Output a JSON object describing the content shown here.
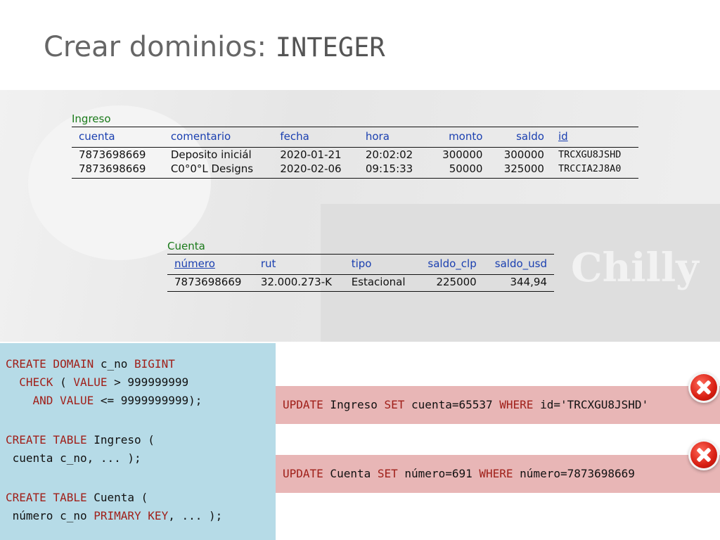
{
  "slide": {
    "title_text": "Crear dominios: ",
    "title_code": "INTEGER",
    "background_watermark": "Chilly"
  },
  "ingreso": {
    "caption": "Ingreso",
    "columns": [
      "cuenta",
      "comentario",
      "fecha",
      "hora",
      "monto",
      "saldo",
      "id"
    ],
    "rows": [
      [
        "7873698669",
        "Deposito iniciál",
        "2020-01-21",
        "20:02:02",
        "300000",
        "300000",
        "TRCXGU8JSHD"
      ],
      [
        "7873698669",
        "C0°0°L Designs",
        "2020-02-06",
        "09:15:33",
        "50000",
        "325000",
        "TRCCIA2J8A0"
      ]
    ]
  },
  "cuenta": {
    "caption": "Cuenta",
    "columns": [
      "número",
      "rut",
      "tipo",
      "saldo_clp",
      "saldo_usd"
    ],
    "rows": [
      [
        "7873698669",
        "32.000.273-K",
        "Estacional",
        "225000",
        "344,94"
      ]
    ]
  },
  "code": {
    "lines": [
      [
        {
          "t": "CREATE DOMAIN",
          "k": true
        },
        {
          "t": " c_no "
        },
        {
          "t": "BIGINT",
          "k": true
        }
      ],
      [
        {
          "t": "  "
        },
        {
          "t": "CHECK",
          "k": true
        },
        {
          "t": " ( "
        },
        {
          "t": "VALUE",
          "k": true
        },
        {
          "t": " > 999999999"
        }
      ],
      [
        {
          "t": "    "
        },
        {
          "t": "AND VALUE",
          "k": true
        },
        {
          "t": " <= 9999999999);"
        }
      ],
      [
        {
          "t": "CREATE TABLE",
          "k": true
        },
        {
          "t": " Ingreso ("
        }
      ],
      [
        {
          "t": " cuenta c_no, ... );"
        }
      ],
      [
        {
          "t": "CREATE TABLE",
          "k": true
        },
        {
          "t": " Cuenta ("
        }
      ],
      [
        {
          "t": " número c_no "
        },
        {
          "t": "PRIMARY KEY",
          "k": true
        },
        {
          "t": ", ... );"
        }
      ]
    ]
  },
  "updates": [
    [
      {
        "t": "UPDATE",
        "k": true
      },
      {
        "t": " Ingreso "
      },
      {
        "t": "SET",
        "k": true
      },
      {
        "t": " cuenta=65537 "
      },
      {
        "t": "WHERE",
        "k": true
      },
      {
        "t": " id='TRCXGU8JSHD'"
      }
    ],
    [
      {
        "t": "UPDATE",
        "k": true
      },
      {
        "t": " Cuenta "
      },
      {
        "t": "SET",
        "k": true
      },
      {
        "t": " número=691 "
      },
      {
        "t": "WHERE",
        "k": true
      },
      {
        "t": " número=7873698669"
      }
    ]
  ],
  "icons": {
    "error": "error-x-icon"
  },
  "colors": {
    "keyword": "#a0201a",
    "table_header": "#1a3fb0",
    "table_caption": "#1a7a1a",
    "code_background": "#b6dbe7",
    "error_background": "#e8b6b6",
    "error_icon": "#d81e12"
  }
}
